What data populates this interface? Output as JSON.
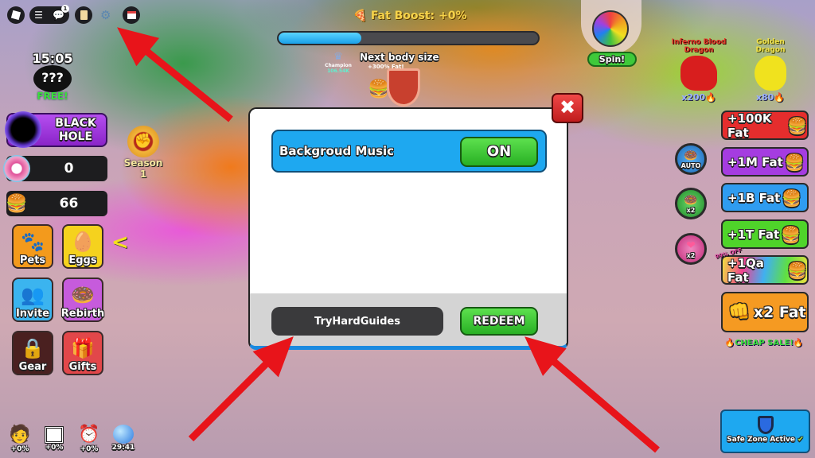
{
  "topbar": {
    "notification_count": "1"
  },
  "timer": {
    "time": "15:05",
    "mystery": "???",
    "free": "FREE!"
  },
  "black_hole": {
    "label_line1": "BLACK",
    "label_line2": "HOLE"
  },
  "counters": [
    {
      "icon": "rebirth-donut-icon",
      "value": "0"
    },
    {
      "icon": "burger-icon",
      "value": "66"
    }
  ],
  "season": {
    "label": "Season 1"
  },
  "menu": [
    {
      "label": "Pets",
      "icon": "paw-icon",
      "color": "#f39a1c"
    },
    {
      "label": "Eggs",
      "icon": "egg-icon",
      "color": "#f5d21e"
    },
    {
      "label": "Invite",
      "icon": "friends-icon",
      "color": "#3bb4ef"
    },
    {
      "label": "Rebirth",
      "icon": "rebirth-icon",
      "color": "#c65bdc"
    },
    {
      "label": "Gear",
      "icon": "lock-icon",
      "color": "#4a2020"
    },
    {
      "label": "Gifts",
      "icon": "gift-icon",
      "color": "#e2474a"
    }
  ],
  "bottom_boosts": [
    {
      "icon": "friend-boost-icon",
      "value": "+0%"
    },
    {
      "icon": "maze-icon",
      "value": "+0%"
    },
    {
      "icon": "clock-icon",
      "value": "+0%"
    },
    {
      "icon": "bubble-icon",
      "value": "29:41"
    }
  ],
  "fat_boost": {
    "label": "Fat Boost: +0%",
    "progress_percent": 32
  },
  "next_body": {
    "label": "Next body size",
    "bonus": "+300% Fat!",
    "rank": "Champion",
    "rank_value": "106.54K"
  },
  "spin": {
    "label": "Spin!"
  },
  "dragons": [
    {
      "name": "Inferno Blood Dragon",
      "multiplier": "x200",
      "color": "#e02020"
    },
    {
      "name": "Golden Dragon",
      "multiplier": "x80",
      "color": "#f0e21e"
    }
  ],
  "modal": {
    "music_label": "Backgroud Music",
    "music_toggle": "ON",
    "code_value": "TryHardGuides",
    "redeem_label": "REDEEM",
    "close_icon": "close-icon"
  },
  "round_buttons": [
    {
      "label": "AUTO",
      "icon": "auto-rebirth-icon",
      "color": "#2f8fd8"
    },
    {
      "label": "x2",
      "icon": "rebirth-x2-icon",
      "color": "#39b54a"
    },
    {
      "label": "x2",
      "icon": "heart-x2-icon",
      "color": "#e0529a"
    }
  ],
  "fat_packs": [
    {
      "label": "+100K Fat",
      "color": "#e52d2d"
    },
    {
      "label": "+1M Fat",
      "color": "#a53ce0"
    },
    {
      "label": "+1B Fat",
      "color": "#2f9cf0"
    },
    {
      "label": "+1T Fat",
      "color": "#4fd42a"
    },
    {
      "label": "+1Qa Fat",
      "color": "rainbow",
      "tag": "99% OFF"
    }
  ],
  "x2_fat": {
    "label": "x2 Fat",
    "sale": "CHEAP SALE!"
  },
  "safe_zone": {
    "label": "Safe Zone Active"
  },
  "arrow_color": "#e8141a"
}
